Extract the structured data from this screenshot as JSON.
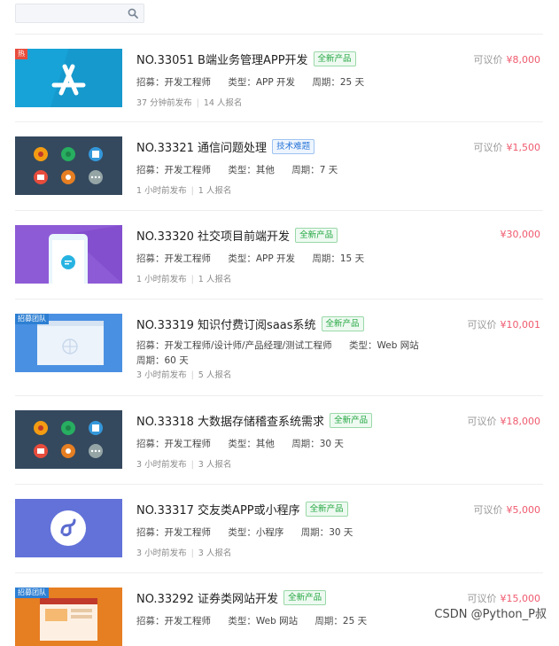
{
  "search": {
    "placeholder": "",
    "value": ""
  },
  "colors": {
    "price": "#ef5a6e",
    "badge_green": "#27a844",
    "badge_blue": "#2a76d8"
  },
  "projects": [
    {
      "thumb": "appstore",
      "corner": "热",
      "title": "NO.33051 B端业务管理APP开发",
      "badge": "全新产品",
      "badge_color": "green",
      "recruit_label": "招募：",
      "recruit": "开发工程师",
      "type_label": "类型：",
      "type": "APP 开发",
      "period_label": "周期：",
      "period": "25 天",
      "posted": "37 分钟前发布",
      "signups": "14 人报名",
      "price_label": "可议价",
      "price": "¥8,000"
    },
    {
      "thumb": "apps-grid",
      "corner": "",
      "title": "NO.33321 通信问题处理",
      "badge": "技术难题",
      "badge_color": "blue",
      "recruit_label": "招募：",
      "recruit": "开发工程师",
      "type_label": "类型：",
      "type": "其他",
      "period_label": "周期：",
      "period": "7 天",
      "posted": "1 小时前发布",
      "signups": "1 人报名",
      "price_label": "可议价",
      "price": "¥1,500"
    },
    {
      "thumb": "mobile-chat",
      "corner": "",
      "title": "NO.33320 社交项目前端开发",
      "badge": "全新产品",
      "badge_color": "green",
      "recruit_label": "招募：",
      "recruit": "开发工程师",
      "type_label": "类型：",
      "type": "APP 开发",
      "period_label": "周期：",
      "period": "15 天",
      "posted": "1 小时前发布",
      "signups": "1 人报名",
      "price_label": "",
      "price": "¥30,000"
    },
    {
      "thumb": "web",
      "corner": "招募团队",
      "title": "NO.33319 知识付费订阅saas系统",
      "badge": "全新产品",
      "badge_color": "green",
      "recruit_label": "招募：",
      "recruit": "开发工程师/设计师/产品经理/测试工程师",
      "type_label": "类型：",
      "type": "Web 网站",
      "period_label": "周期：",
      "period": "60 天",
      "posted": "3 小时前发布",
      "signups": "5 人报名",
      "price_label": "可议价",
      "price": "¥10,001"
    },
    {
      "thumb": "apps-grid",
      "corner": "",
      "title": "NO.33318 大数据存储稽查系统需求",
      "badge": "全新产品",
      "badge_color": "green",
      "recruit_label": "招募：",
      "recruit": "开发工程师",
      "type_label": "类型：",
      "type": "其他",
      "period_label": "周期：",
      "period": "30 天",
      "posted": "3 小时前发布",
      "signups": "3 人报名",
      "price_label": "可议价",
      "price": "¥18,000"
    },
    {
      "thumb": "miniprogram",
      "corner": "",
      "title": "NO.33317 交友类APP或小程序",
      "badge": "全新产品",
      "badge_color": "green",
      "recruit_label": "招募：",
      "recruit": "开发工程师",
      "type_label": "类型：",
      "type": "小程序",
      "period_label": "周期：",
      "period": "30 天",
      "posted": "3 小时前发布",
      "signups": "3 人报名",
      "price_label": "可议价",
      "price": "¥5,000"
    },
    {
      "thumb": "web-orange",
      "corner": "招募团队",
      "title": "NO.33292 证券类网站开发",
      "badge": "全新产品",
      "badge_color": "green",
      "recruit_label": "招募：",
      "recruit": "开发工程师",
      "type_label": "类型：",
      "type": "Web 网站",
      "period_label": "周期：",
      "period": "25 天",
      "posted": "",
      "signups": "",
      "price_label": "可议价",
      "price": "¥15,000"
    }
  ],
  "watermark": "CSDN @Python_P叔"
}
